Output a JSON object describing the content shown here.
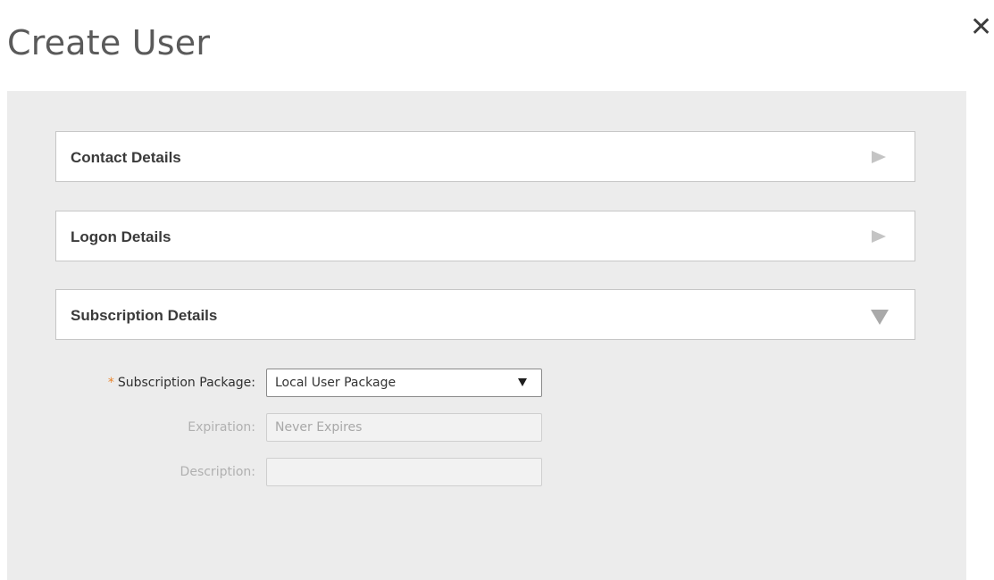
{
  "dialog": {
    "title": "Create User",
    "close_symbol": "✕"
  },
  "sections": [
    {
      "label": "Contact Details",
      "state": "collapsed",
      "icon": "chevron-right-icon"
    },
    {
      "label": "Logon Details",
      "state": "collapsed",
      "icon": "chevron-right-icon"
    },
    {
      "label": "Subscription Details",
      "state": "expanded",
      "icon": "chevron-down-icon"
    }
  ],
  "subscription_form": {
    "required_marker": "*",
    "package_label": "Subscription Package:",
    "package_value": "Local User Package",
    "expiration_label": "Expiration:",
    "expiration_value": "Never Expires",
    "description_label": "Description:",
    "description_value": ""
  },
  "colors": {
    "panel_background": "#ececec",
    "required_marker": "#e8842c",
    "disabled_text": "#b0b0b0"
  }
}
